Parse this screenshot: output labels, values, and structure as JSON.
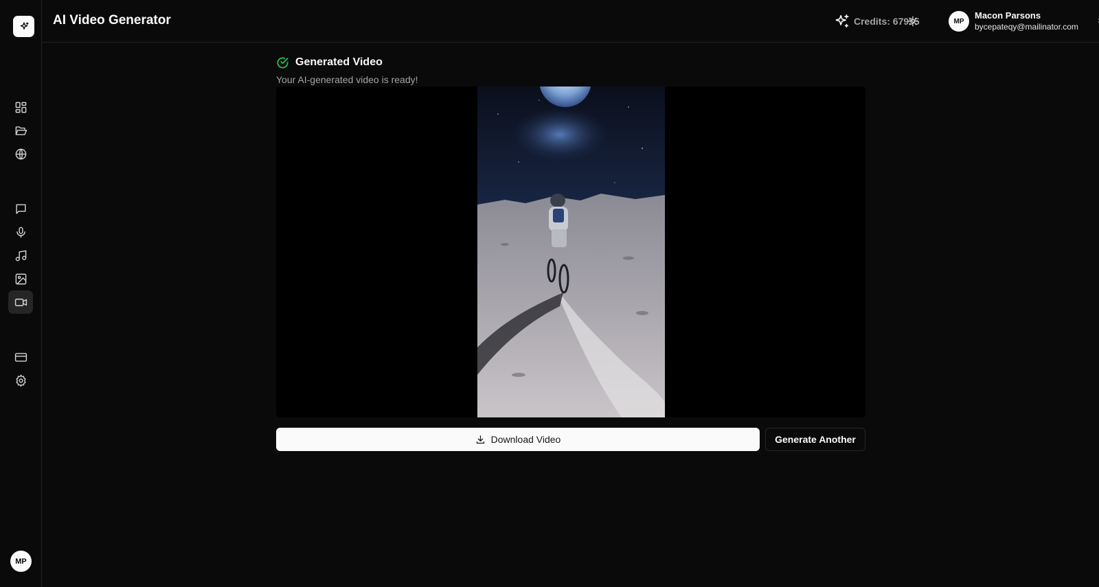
{
  "header": {
    "title": "AI Video Generator",
    "credits_label": "Credits: 67955"
  },
  "user": {
    "initials": "MP",
    "name": "Macon Parsons",
    "email": "bycepateqy@mailinator.com"
  },
  "sidebar": {
    "avatar_initials": "MP",
    "items": [
      {
        "icon": "dashboard-icon"
      },
      {
        "icon": "folder-open-icon"
      },
      {
        "icon": "globe-icon"
      },
      {
        "icon": "chat-icon"
      },
      {
        "icon": "microphone-icon"
      },
      {
        "icon": "music-icon"
      },
      {
        "icon": "image-icon"
      },
      {
        "icon": "video-icon",
        "active": true
      },
      {
        "icon": "credit-card-icon"
      },
      {
        "icon": "gear-icon"
      }
    ]
  },
  "result": {
    "title": "Generated Video",
    "subtitle": "Your AI-generated video is ready!"
  },
  "actions": {
    "download_label": "Download Video",
    "generate_label": "Generate Another"
  },
  "colors": {
    "background": "#0a0a0a",
    "success": "#22c55e",
    "primary_button": "#fafafa"
  }
}
